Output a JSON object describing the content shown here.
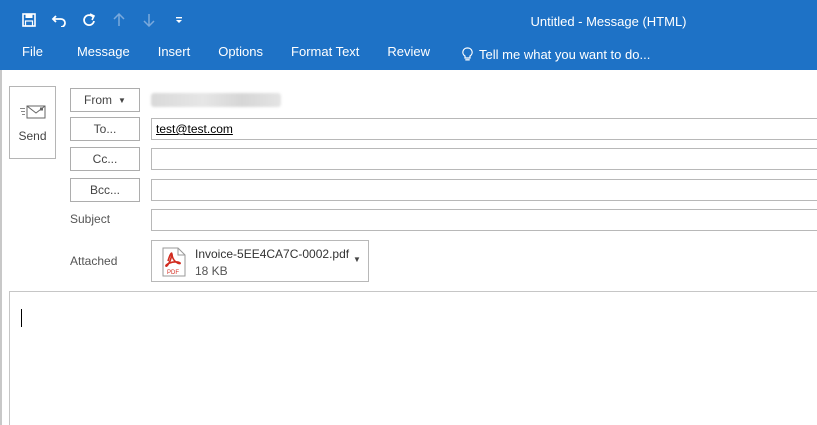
{
  "window": {
    "title": "Untitled - Message (HTML)"
  },
  "colors": {
    "ribbon": "#1e72c6",
    "pdf_red": "#d12b1f"
  },
  "quick_access": [
    {
      "name": "save-icon"
    },
    {
      "name": "undo-icon"
    },
    {
      "name": "redo-icon"
    },
    {
      "name": "up-arrow-icon"
    },
    {
      "name": "down-arrow-icon"
    },
    {
      "name": "customize-qat-icon"
    }
  ],
  "ribbon": {
    "tabs": [
      "File",
      "Message",
      "Insert",
      "Options",
      "Format Text",
      "Review"
    ],
    "tell_me": "Tell me what you want to do..."
  },
  "compose": {
    "send_label": "Send",
    "from_label": "From",
    "to_label": "To...",
    "cc_label": "Cc...",
    "bcc_label": "Bcc...",
    "to_value": "test@test.com",
    "cc_value": "",
    "bcc_value": "",
    "subject_label": "Subject",
    "subject_value": "",
    "attached_label": "Attached",
    "attachment": {
      "file_name": "Invoice-5EE4CA7C-0002.pdf",
      "size": "18 KB",
      "icon": "pdf-icon",
      "icon_text": "PDF"
    }
  }
}
